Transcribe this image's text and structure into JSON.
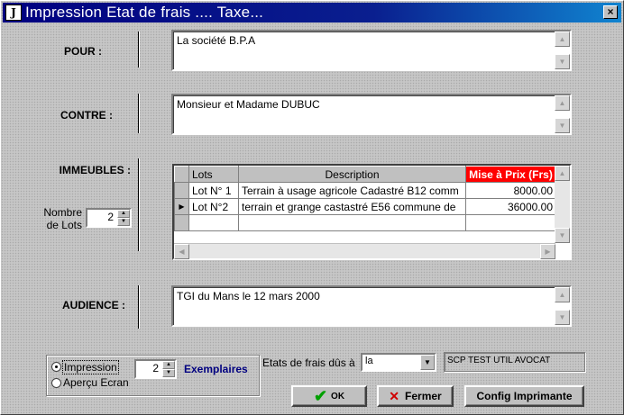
{
  "window": {
    "title": "Impression Etat de frais .... Taxe...",
    "icon_letter": "J",
    "close_label": "×"
  },
  "pour": {
    "label": "POUR :",
    "value": "La société B.P.A"
  },
  "contre": {
    "label": "CONTRE :",
    "value": "Monsieur et Madame DUBUC"
  },
  "immeubles": {
    "label": "IMMEUBLES :",
    "nombre_label_1": "Nombre",
    "nombre_label_2": "de Lots",
    "nombre_value": "2",
    "columns": [
      "Lots",
      "Description",
      "Mise à Prix (Frs)"
    ],
    "rows": [
      {
        "indicator": "",
        "lot": "Lot N° 1",
        "description": "Terrain à usage agricole Cadastré B12 comm",
        "price": "8000.00"
      },
      {
        "indicator": "▶",
        "lot": "Lot N°2",
        "description": "terrain et grange castastré E56 commune de",
        "price": "36000.00"
      }
    ]
  },
  "audience": {
    "label": "AUDIENCE :",
    "value": "TGI du Mans le 12 mars 2000"
  },
  "output": {
    "impression_label": "Impression",
    "apercu_label": "Aperçu Ecran",
    "selected": "Impression",
    "copies_value": "2",
    "copies_label": "Exemplaires"
  },
  "etats": {
    "label": "Etats de frais dûs à",
    "selected": "la",
    "office": "SCP TEST UTIL AVOCAT"
  },
  "buttons": {
    "ok": "OK",
    "fermer": "Fermer",
    "config": "Config Imprimante"
  },
  "icons": {
    "up": "▲",
    "down": "▼",
    "left": "◀",
    "right": "▶",
    "ok_icon": "✔",
    "close_icon": "✕"
  },
  "colors": {
    "title_bar": "#000080",
    "price_header": "#ff0000",
    "exemplaires_label": "#000080",
    "ok_check": "#00a000",
    "fermer_x": "#d00000"
  }
}
